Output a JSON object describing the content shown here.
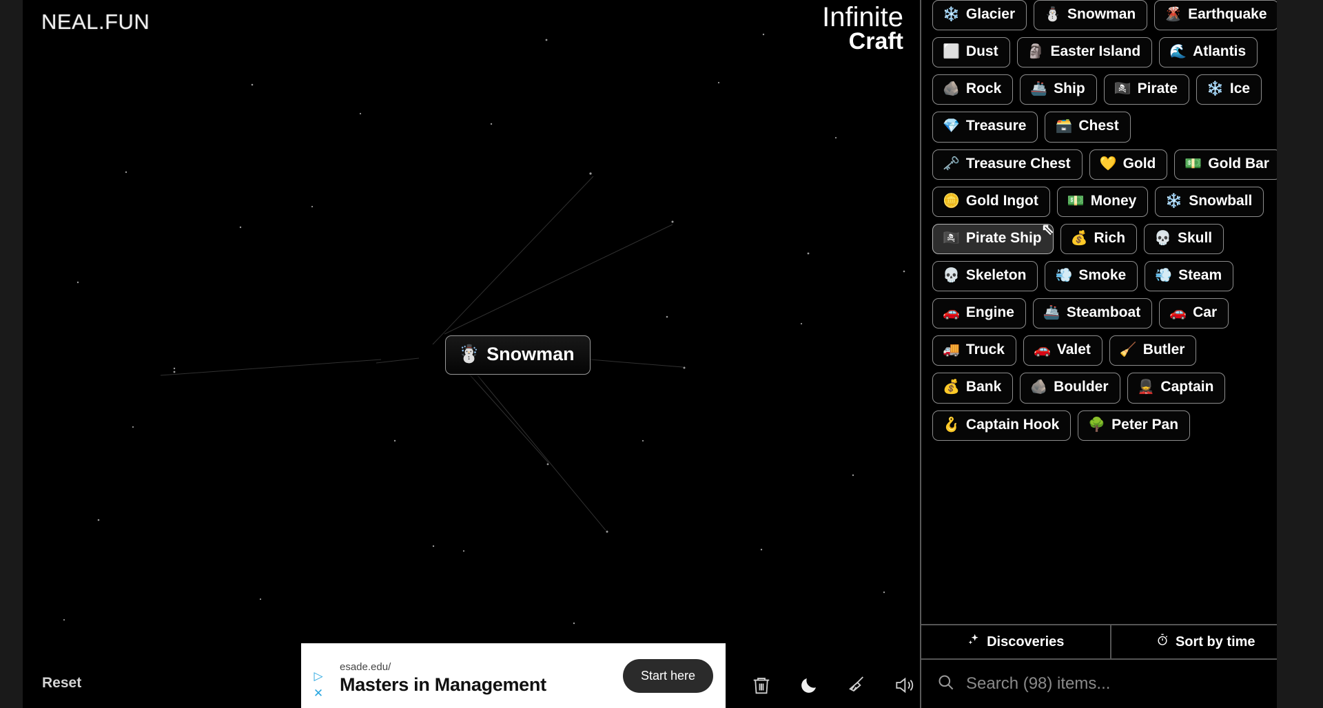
{
  "brand": "NEAL.FUN",
  "game_title": {
    "line1": "Infinite",
    "line2": "Craft"
  },
  "canvas": {
    "reset_label": "Reset",
    "node": {
      "emoji": "☃️",
      "label": "Snowman"
    }
  },
  "toolbar": {
    "icons": [
      {
        "name": "trash-icon",
        "title": "Clear board"
      },
      {
        "name": "moon-icon",
        "title": "Dark mode"
      },
      {
        "name": "broom-icon",
        "title": "Tidy up"
      },
      {
        "name": "speaker-icon",
        "title": "Sound"
      }
    ]
  },
  "ad": {
    "url": "esade.edu/",
    "title": "Masters in Management",
    "cta": "Start here",
    "adchoices_glyph": "▷",
    "close_glyph": "✕"
  },
  "sidebar": {
    "items": [
      {
        "emoji": "❄️",
        "label": "Glacier"
      },
      {
        "emoji": "⛄",
        "label": "Snowman"
      },
      {
        "emoji": "🌋",
        "label": "Earthquake"
      },
      {
        "emoji": "⬜",
        "label": "Dust"
      },
      {
        "emoji": "🗿",
        "label": "Easter Island"
      },
      {
        "emoji": "🌊",
        "label": "Atlantis"
      },
      {
        "emoji": "🪨",
        "label": "Rock"
      },
      {
        "emoji": "🚢",
        "label": "Ship"
      },
      {
        "emoji": "🏴‍☠️",
        "label": "Pirate"
      },
      {
        "emoji": "❄️",
        "label": "Ice"
      },
      {
        "emoji": "💎",
        "label": "Treasure"
      },
      {
        "emoji": "🗃️",
        "label": "Chest"
      },
      {
        "emoji": "🗝️",
        "label": "Treasure Chest"
      },
      {
        "emoji": "💛",
        "label": "Gold"
      },
      {
        "emoji": "💵",
        "label": "Gold Bar"
      },
      {
        "emoji": "🪙",
        "label": "Gold Ingot"
      },
      {
        "emoji": "💵",
        "label": "Money"
      },
      {
        "emoji": "❄️",
        "label": "Snowball"
      },
      {
        "emoji": "🏴‍☠️",
        "label": "Pirate Ship",
        "hovered": true
      },
      {
        "emoji": "💰",
        "label": "Rich"
      },
      {
        "emoji": "💀",
        "label": "Skull"
      },
      {
        "emoji": "💀",
        "label": "Skeleton"
      },
      {
        "emoji": "💨",
        "label": "Smoke"
      },
      {
        "emoji": "💨",
        "label": "Steam"
      },
      {
        "emoji": "🚗",
        "label": "Engine"
      },
      {
        "emoji": "🚢",
        "label": "Steamboat"
      },
      {
        "emoji": "🚗",
        "label": "Car"
      },
      {
        "emoji": "🚚",
        "label": "Truck"
      },
      {
        "emoji": "🚗",
        "label": "Valet"
      },
      {
        "emoji": "🧹",
        "label": "Butler"
      },
      {
        "emoji": "💰",
        "label": "Bank"
      },
      {
        "emoji": "🪨",
        "label": "Boulder"
      },
      {
        "emoji": "💂",
        "label": "Captain"
      },
      {
        "emoji": "🪝",
        "label": "Captain Hook"
      },
      {
        "emoji": "🌳",
        "label": "Peter Pan"
      }
    ],
    "tabs": [
      {
        "name": "discoveries",
        "label": "Discoveries",
        "icon": "sparkles-icon"
      },
      {
        "name": "sort-by-time",
        "label": "Sort by time",
        "icon": "stopwatch-icon"
      }
    ],
    "search": {
      "placeholder": "Search (98) items...",
      "value": "",
      "count": 98
    }
  }
}
